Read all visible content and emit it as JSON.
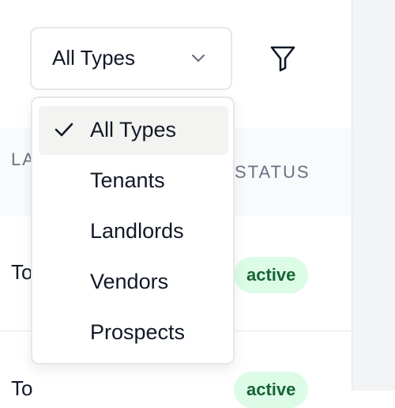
{
  "table": {
    "headers": {
      "last_contact": "LAST CONTACT",
      "status": "STATUS"
    },
    "rows": [
      {
        "last_contact": "Today",
        "status": "active"
      },
      {
        "last_contact": "Today",
        "status": "active"
      }
    ]
  },
  "type_filter": {
    "selected": "All Types",
    "options": [
      "All Types",
      "Tenants",
      "Landlords",
      "Vendors",
      "Prospects"
    ]
  },
  "icons": {
    "select_toggle": "chevron-down-icon",
    "filter": "filter-icon",
    "selected_mark": "check-icon"
  },
  "colors": {
    "status_badge_bg": "#dcfce7",
    "status_badge_text": "#166534",
    "selected_item_bg": "#f3f4f1"
  }
}
